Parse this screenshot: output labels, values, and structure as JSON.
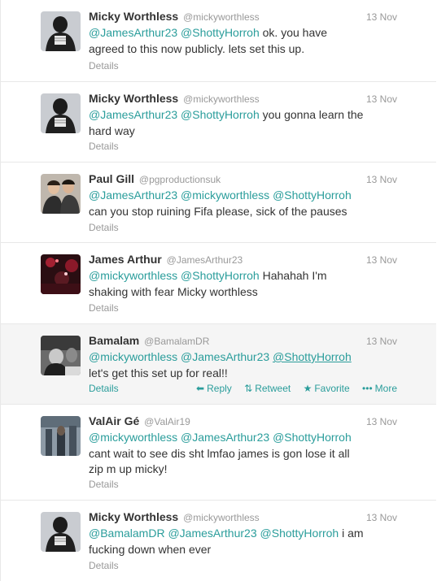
{
  "colors": {
    "link": "#2a9d9b",
    "muted": "#999999",
    "text": "#333333",
    "hover_bg": "#f5f5f5"
  },
  "tweet_actions": {
    "reply": "Reply",
    "retweet": "Retweet",
    "favorite": "Favorite",
    "more": "More"
  },
  "tweets": [
    {
      "fullname": "Micky Worthless",
      "username": "@mickyworthless",
      "time": "13 Nov",
      "mentions": [
        "@JamesArthur23",
        "@ShottyHorroh"
      ],
      "text": "ok. you have agreed to this now publicly. lets set this up.",
      "details": "Details"
    },
    {
      "fullname": "Micky Worthless",
      "username": "@mickyworthless",
      "time": "13 Nov",
      "mentions": [
        "@JamesArthur23",
        "@ShottyHorroh"
      ],
      "text": "you gonna learn the hard way",
      "details": "Details"
    },
    {
      "fullname": "Paul Gill",
      "username": "@pgproductionsuk",
      "time": "13 Nov",
      "mentions": [
        "@JamesArthur23",
        "@mickyworthless",
        "@ShottyHorroh"
      ],
      "text": "can you stop ruining Fifa please, sick of the pauses",
      "details": "Details"
    },
    {
      "fullname": "James Arthur",
      "username": "@JamesArthur23",
      "time": "13 Nov",
      "mentions": [
        "@mickyworthless",
        "@ShottyHorroh"
      ],
      "text": "Hahahah I'm shaking with fear Micky worthless",
      "details": "Details"
    },
    {
      "fullname": "Bamalam",
      "username": "@BamalamDR",
      "time": "13 Nov",
      "mentions": [
        "@mickyworthless",
        "@JamesArthur23",
        "@ShottyHorroh"
      ],
      "text": "let's get this set up for real!!",
      "details": "Details"
    },
    {
      "fullname": "ValAir Gé",
      "username": "@ValAir19",
      "time": "13 Nov",
      "mentions": [
        "@mickyworthless",
        "@JamesArthur23",
        "@ShottyHorroh"
      ],
      "text": "cant wait to see dis sht lmfao james is gon lose it all zip m up micky!",
      "details": "Details"
    },
    {
      "fullname": "Micky Worthless",
      "username": "@mickyworthless",
      "time": "13 Nov",
      "mentions": [
        "@BamalamDR",
        "@JamesArthur23",
        "@ShottyHorroh"
      ],
      "text": "i am fucking down when ever",
      "details": "Details"
    }
  ]
}
